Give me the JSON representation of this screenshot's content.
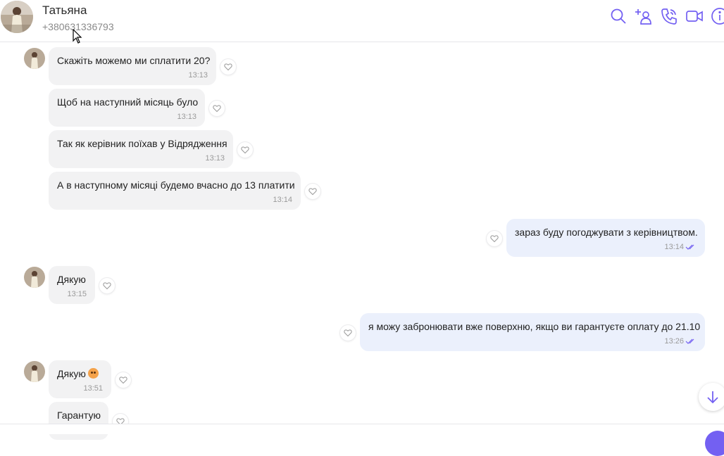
{
  "header": {
    "contact_name": "Татьяна",
    "contact_phone": "+380631336793",
    "icons": [
      "search-icon",
      "add-participant-icon",
      "phone-icon",
      "video-icon",
      "info-icon"
    ],
    "accent_color": "#7360f2"
  },
  "messages": [
    {
      "direction": "in",
      "text": "Скажіть можемо ми сплатити 20?",
      "time": "13:13"
    },
    {
      "direction": "in",
      "text": "Щоб на наступний місяць було",
      "time": "13:13"
    },
    {
      "direction": "in",
      "text": "Так як керівник поїхав у Відрядження",
      "time": "13:13"
    },
    {
      "direction": "in",
      "text": "А в наступному місяці будемо вчасно до 13 платити",
      "time": "13:14"
    },
    {
      "direction": "out",
      "text": "зараз буду погоджувати з керівництвом.",
      "time": "13:14",
      "status": "read"
    },
    {
      "direction": "in",
      "text": "Дякую",
      "time": "13:15"
    },
    {
      "direction": "out",
      "text": "я можу забронювати вже поверхню, якщо ви гарантуєте оплату до 21.10",
      "time": "13:26",
      "status": "read"
    },
    {
      "direction": "in",
      "text": "Дякую",
      "emoji": "smiling-face-with-hearts",
      "time": "13:51"
    },
    {
      "direction": "in",
      "text": "Гарантую",
      "time": ""
    }
  ]
}
